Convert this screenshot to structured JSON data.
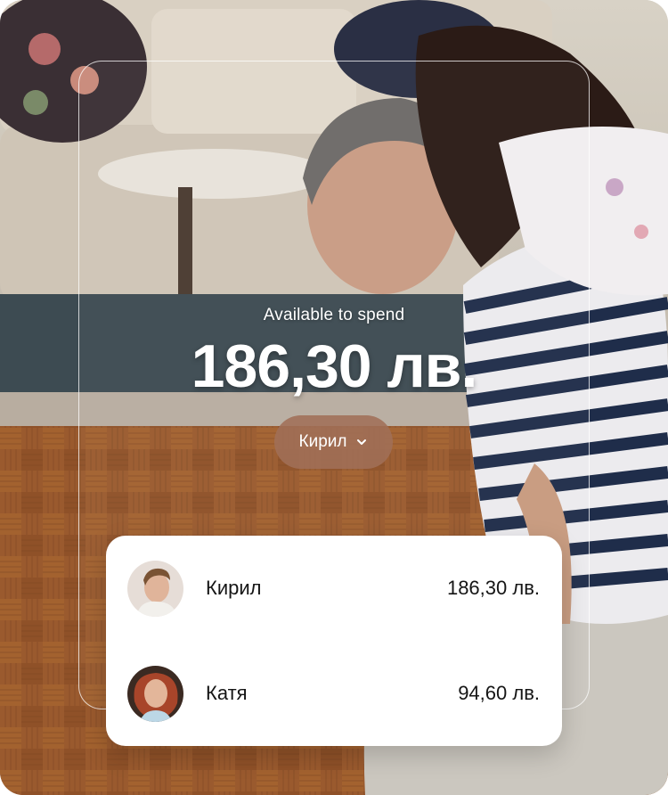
{
  "balance_section": {
    "label": "Available to spend",
    "amount": "186,30 лв."
  },
  "account_selector": {
    "selected": "Кирил",
    "icon": "chevron-down-icon"
  },
  "accounts": [
    {
      "name": "Кирил",
      "amount": "186,30 лв.",
      "avatar": "avatar-kiril"
    },
    {
      "name": "Катя",
      "amount": "94,60 лв.",
      "avatar": "avatar-katya"
    }
  ]
}
